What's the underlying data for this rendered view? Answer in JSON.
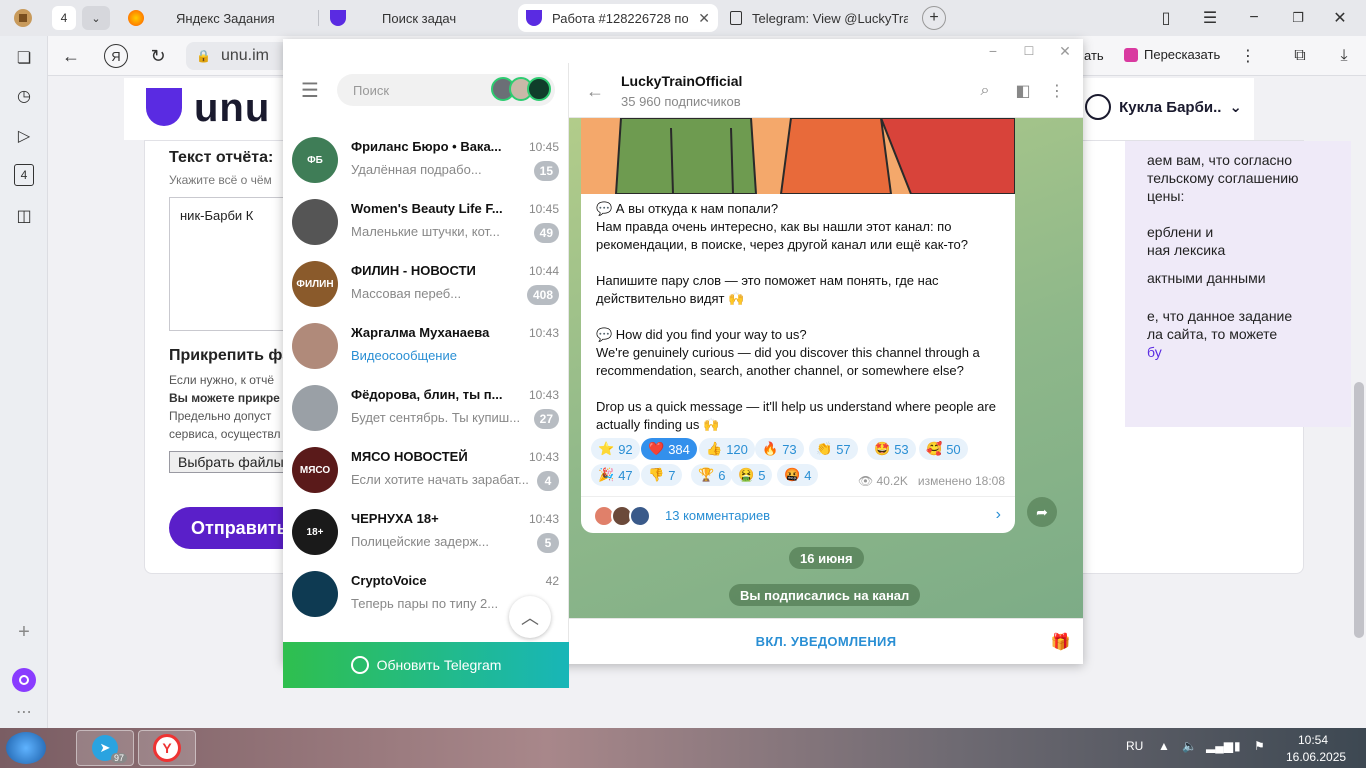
{
  "browser": {
    "tab_count": "4",
    "tabs": [
      {
        "label": "Яндекс Задания"
      },
      {
        "label": "Поиск задач"
      },
      {
        "label": "Работа #128226728 по"
      },
      {
        "label": "Telegram: View @LuckyTra"
      }
    ],
    "address": "unu.im",
    "toolbar_right": {
      "translate_partial": "ать",
      "retell": "Пересказать"
    }
  },
  "site": {
    "logo_text": "unu",
    "user_name": "Кукла Барби..",
    "form": {
      "report_title": "Текст отчёта:",
      "report_hint": "Укажите всё о чём",
      "report_value": "ник-Барби К",
      "attach_title": "Прикрепить фа",
      "attach_line1": "Если нужно, к отчё",
      "attach_line2": "Вы можете прикре",
      "attach_line3": "Предельно допуст",
      "attach_line4": "сервиса, осуществл",
      "file_button": "Выбрать файлы",
      "send_button": "Отправить"
    },
    "note_lines": [
      "аем вам, что согласно",
      "тельскому соглашению",
      "цены:",
      "",
      "ерблени и",
      "ная лексика",
      "",
      "актными данными",
      "",
      "е, что данное задание",
      "ла сайта, то можете",
      "бу"
    ]
  },
  "telegram": {
    "search_placeholder": "Поиск",
    "chats": [
      {
        "name": "Фриланс Бюро • Вака...",
        "time": "10:45",
        "preview": "Удалённая подрабо...",
        "badge": "15",
        "avatar_color": "#3f7d57",
        "avatar_text": "ФБ"
      },
      {
        "name": "Women's Beauty Life F...",
        "time": "10:45",
        "preview": "Маленькие штучки, кот...",
        "badge": "49",
        "avatar_color": "#555555",
        "avatar_text": ""
      },
      {
        "name": "ФИЛИН - НОВОСТИ",
        "time": "10:44",
        "preview": "Массовая переб...",
        "badge": "408",
        "avatar_color": "#8a5a2b",
        "avatar_text": "ФИЛИН"
      },
      {
        "name": "Жаргалма Муханаева",
        "time": "10:43",
        "preview": "Видеосообщение",
        "badge": "",
        "avatar_color": "#b08a7a",
        "avatar_text": ""
      },
      {
        "name": "Фёдорова, блин, ты п...",
        "time": "10:43",
        "preview": "Будет сентябрь. Ты купиш...",
        "badge": "27",
        "avatar_color": "#9aa0a6",
        "avatar_text": ""
      },
      {
        "name": "МЯСО НОВОСТЕЙ",
        "time": "10:43",
        "preview": "Если хотите начать зарабат...",
        "badge": "4",
        "avatar_color": "#5a1a1a",
        "avatar_text": "МЯСО"
      },
      {
        "name": "ЧЕРНУХА 18+",
        "time": "10:43",
        "preview": "Полицейские задерж...",
        "badge": "5",
        "avatar_color": "#1a1a1a",
        "avatar_text": "18+"
      },
      {
        "name": "CryptoVoice",
        "time": "42",
        "preview": "Теперь пары по типу 2...",
        "badge": "",
        "avatar_color": "#0e3a52",
        "avatar_text": ""
      }
    ],
    "update_button": "Обновить Telegram",
    "channel": {
      "name": "LuckyTrainOfficial",
      "subscribers": "35 960 подписчиков"
    },
    "post": {
      "text": "💬 А вы откуда к нам попали?\nНам правда очень интересно, как вы нашли этот канал: по рекомендации, в поиске, через другой канал или ещё как-то?\n\nНапишите пару слов — это поможет нам понять, где нас действительно видят 🙌\n\n💬 How did you find your way to us?\nWe're genuinely curious — did you discover this channel through a recommendation, search, another channel, or somewhere else?\n\nDrop us a quick message — it'll help us understand where people are actually finding us 🙌",
      "reactions": [
        {
          "emoji": "⭐",
          "count": "92"
        },
        {
          "emoji": "❤️",
          "count": "384"
        },
        {
          "emoji": "👍",
          "count": "120"
        },
        {
          "emoji": "🔥",
          "count": "73"
        },
        {
          "emoji": "👏",
          "count": "57"
        },
        {
          "emoji": "🤩",
          "count": "53"
        },
        {
          "emoji": "🥰",
          "count": "50"
        },
        {
          "emoji": "🎉",
          "count": "47"
        },
        {
          "emoji": "👎",
          "count": "7"
        },
        {
          "emoji": "🏆",
          "count": "6"
        },
        {
          "emoji": "🤮",
          "count": "5"
        },
        {
          "emoji": "🤬",
          "count": "4"
        }
      ],
      "views": "40.2K",
      "edited": "изменено 18:08",
      "comments": "13 комментариев"
    },
    "date_label": "16 июня",
    "service_message": "Вы подписались на канал",
    "notif_button": "ВКЛ. УВЕДОМЛЕНИЯ"
  },
  "taskbar": {
    "telegram_badge": "97",
    "lang": "RU",
    "time": "10:54",
    "date": "16.06.2025"
  }
}
